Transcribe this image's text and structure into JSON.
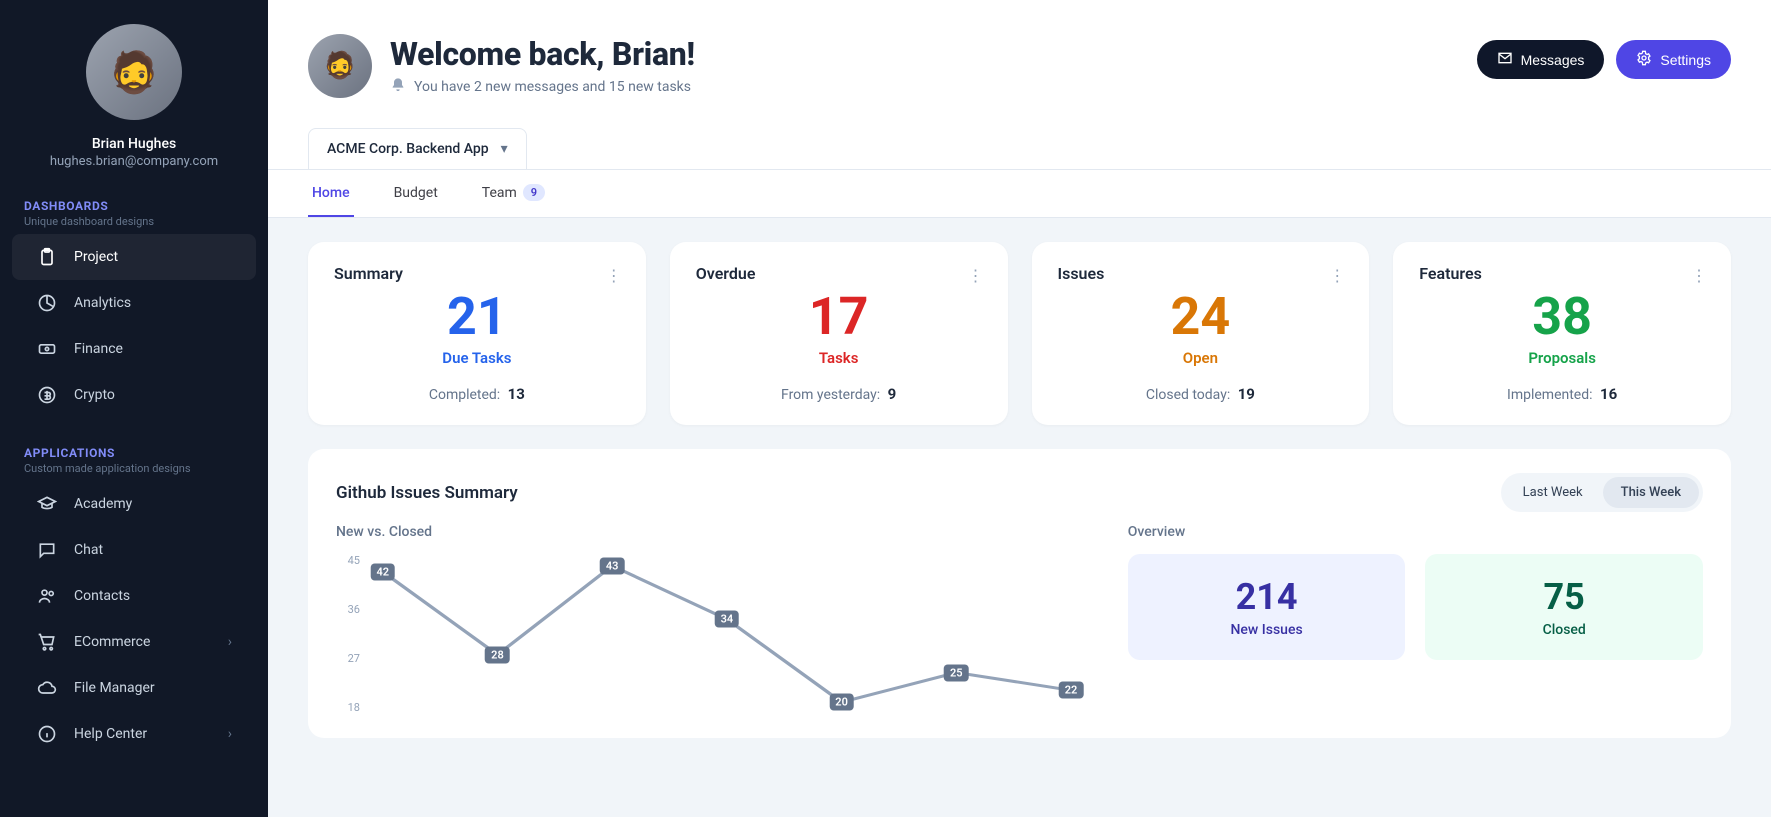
{
  "user": {
    "name": "Brian Hughes",
    "email": "hughes.brian@company.com",
    "emoji": "🧔"
  },
  "sidebar": {
    "groups": [
      {
        "title": "DASHBOARDS",
        "subtitle": "Unique dashboard designs"
      },
      {
        "title": "APPLICATIONS",
        "subtitle": "Custom made application designs"
      }
    ],
    "dashboards": [
      {
        "label": "Project",
        "icon": "clipboard-icon"
      },
      {
        "label": "Analytics",
        "icon": "chart-pie-icon"
      },
      {
        "label": "Finance",
        "icon": "cash-icon"
      },
      {
        "label": "Crypto",
        "icon": "currency-icon"
      }
    ],
    "applications": [
      {
        "label": "Academy",
        "icon": "academic-cap-icon",
        "expandable": false
      },
      {
        "label": "Chat",
        "icon": "chat-icon",
        "expandable": false
      },
      {
        "label": "Contacts",
        "icon": "users-icon",
        "expandable": false
      },
      {
        "label": "ECommerce",
        "icon": "cart-icon",
        "expandable": true
      },
      {
        "label": "File Manager",
        "icon": "cloud-icon",
        "expandable": false
      },
      {
        "label": "Help Center",
        "icon": "info-icon",
        "expandable": true
      }
    ]
  },
  "header": {
    "title": "Welcome back, Brian!",
    "subtitle": "You have 2 new messages and 15 new tasks",
    "messages_btn": "Messages",
    "settings_btn": "Settings",
    "project_selector": "ACME Corp. Backend App"
  },
  "tabs": [
    {
      "label": "Home",
      "active": true
    },
    {
      "label": "Budget",
      "active": false
    },
    {
      "label": "Team",
      "active": false,
      "badge": "9"
    }
  ],
  "stat_cards": [
    {
      "title": "Summary",
      "value": "21",
      "label": "Due Tasks",
      "foot_label": "Completed:",
      "foot_value": "13",
      "color": "c-blue"
    },
    {
      "title": "Overdue",
      "value": "17",
      "label": "Tasks",
      "foot_label": "From yesterday:",
      "foot_value": "9",
      "color": "c-red"
    },
    {
      "title": "Issues",
      "value": "24",
      "label": "Open",
      "foot_label": "Closed today:",
      "foot_value": "19",
      "color": "c-amber"
    },
    {
      "title": "Features",
      "value": "38",
      "label": "Proposals",
      "foot_label": "Implemented:",
      "foot_value": "16",
      "color": "c-green"
    }
  ],
  "github": {
    "title": "Github Issues Summary",
    "range_options": [
      "Last Week",
      "This Week"
    ],
    "range_active": "This Week",
    "left_label": "New vs. Closed",
    "right_label": "Overview",
    "overview": [
      {
        "value": "214",
        "label": "New Issues",
        "cls": "ov-indigo"
      },
      {
        "value": "75",
        "label": "Closed",
        "cls": "ov-green"
      }
    ]
  },
  "chart_data": {
    "type": "line",
    "title": "New vs. Closed",
    "xlabel": "",
    "ylabel": "",
    "ylim": [
      18,
      45
    ],
    "y_ticks": [
      45,
      36,
      27,
      18
    ],
    "series": [
      {
        "name": "New",
        "values": [
          42,
          28,
          43,
          34,
          20,
          25,
          22
        ]
      }
    ],
    "x": [
      0,
      1,
      2,
      3,
      4,
      5,
      6
    ]
  }
}
